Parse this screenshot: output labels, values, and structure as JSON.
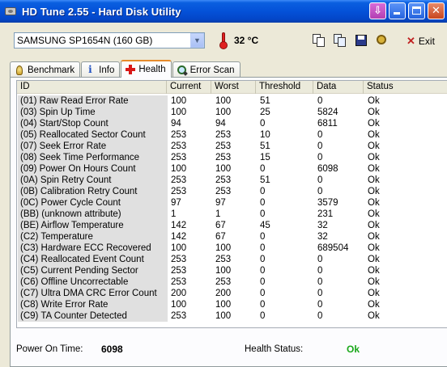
{
  "window": {
    "title": "HD Tune 2.55 - Hard Disk Utility"
  },
  "toolbar": {
    "drive": "SAMSUNG SP1654N (160 GB)",
    "temperature": "32 °C",
    "exit_label": "Exit"
  },
  "tabs": [
    {
      "label": "Benchmark",
      "icon": "benchmark-icon",
      "active": false
    },
    {
      "label": "Info",
      "icon": "info-icon",
      "active": false
    },
    {
      "label": "Health",
      "icon": "health-cross-icon",
      "active": true
    },
    {
      "label": "Error Scan",
      "icon": "magnifier-icon",
      "active": false
    }
  ],
  "table": {
    "columns": [
      "ID",
      "Current",
      "Worst",
      "Threshold",
      "Data",
      "Status"
    ],
    "rows": [
      [
        "(01) Raw Read Error Rate",
        "100",
        "100",
        "51",
        "0",
        "Ok"
      ],
      [
        "(03) Spin Up Time",
        "100",
        "100",
        "25",
        "5824",
        "Ok"
      ],
      [
        "(04) Start/Stop Count",
        "94",
        "94",
        "0",
        "6811",
        "Ok"
      ],
      [
        "(05) Reallocated Sector Count",
        "253",
        "253",
        "10",
        "0",
        "Ok"
      ],
      [
        "(07) Seek Error Rate",
        "253",
        "253",
        "51",
        "0",
        "Ok"
      ],
      [
        "(08) Seek Time Performance",
        "253",
        "253",
        "15",
        "0",
        "Ok"
      ],
      [
        "(09) Power On Hours Count",
        "100",
        "100",
        "0",
        "6098",
        "Ok"
      ],
      [
        "(0A) Spin Retry Count",
        "253",
        "253",
        "51",
        "0",
        "Ok"
      ],
      [
        "(0B) Calibration Retry Count",
        "253",
        "253",
        "0",
        "0",
        "Ok"
      ],
      [
        "(0C) Power Cycle Count",
        "97",
        "97",
        "0",
        "3579",
        "Ok"
      ],
      [
        "(BB) (unknown attribute)",
        "1",
        "1",
        "0",
        "231",
        "Ok"
      ],
      [
        "(BE) Airflow Temperature",
        "142",
        "67",
        "45",
        "32",
        "Ok"
      ],
      [
        "(C2) Temperature",
        "142",
        "67",
        "0",
        "32",
        "Ok"
      ],
      [
        "(C3) Hardware ECC Recovered",
        "100",
        "100",
        "0",
        "689504",
        "Ok"
      ],
      [
        "(C4) Reallocated Event Count",
        "253",
        "253",
        "0",
        "0",
        "Ok"
      ],
      [
        "(C5) Current Pending Sector",
        "253",
        "100",
        "0",
        "0",
        "Ok"
      ],
      [
        "(C6) Offline Uncorrectable",
        "253",
        "253",
        "0",
        "0",
        "Ok"
      ],
      [
        "(C7) Ultra DMA CRC Error Count",
        "200",
        "200",
        "0",
        "0",
        "Ok"
      ],
      [
        "(C8) Write Error Rate",
        "100",
        "100",
        "0",
        "0",
        "Ok"
      ],
      [
        "(C9) TA Counter Detected",
        "253",
        "100",
        "0",
        "0",
        "Ok"
      ]
    ]
  },
  "footer": {
    "power_on_label": "Power On Time:",
    "power_on_value": "6098",
    "health_label": "Health Status:",
    "health_value": "Ok",
    "health_color": "#1aa81a"
  }
}
